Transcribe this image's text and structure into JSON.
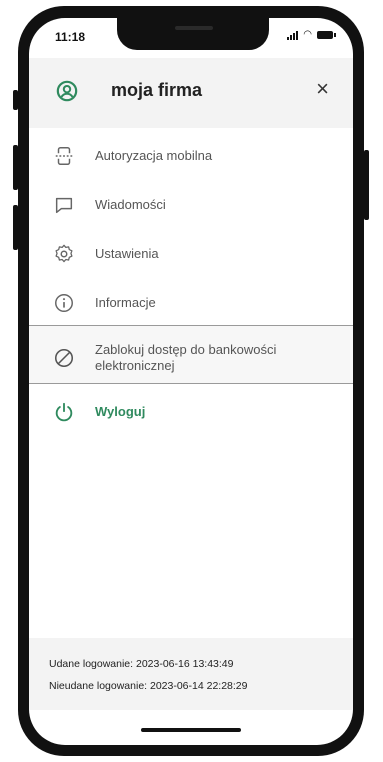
{
  "status": {
    "time": "11:18"
  },
  "header": {
    "title": "moja firma",
    "close_label": "×"
  },
  "menu": [
    {
      "label": "Autoryzacja mobilna",
      "icon": "mobile-auth-icon"
    },
    {
      "label": "Wiadomości",
      "icon": "message-icon"
    },
    {
      "label": "Ustawienia",
      "icon": "gear-icon"
    },
    {
      "label": "Informacje",
      "icon": "info-icon"
    },
    {
      "label": "Zablokuj dostęp do bankowości elektronicznej",
      "icon": "block-icon"
    },
    {
      "label": "Wyloguj",
      "icon": "power-icon"
    }
  ],
  "footer": {
    "success_login": "Udane logowanie: 2023-06-16 13:43:49",
    "failed_login": "Nieudane logowanie: 2023-06-14 22:28:29"
  },
  "colors": {
    "accent": "#2f8a5e",
    "header_bg": "#f3f3f3"
  }
}
